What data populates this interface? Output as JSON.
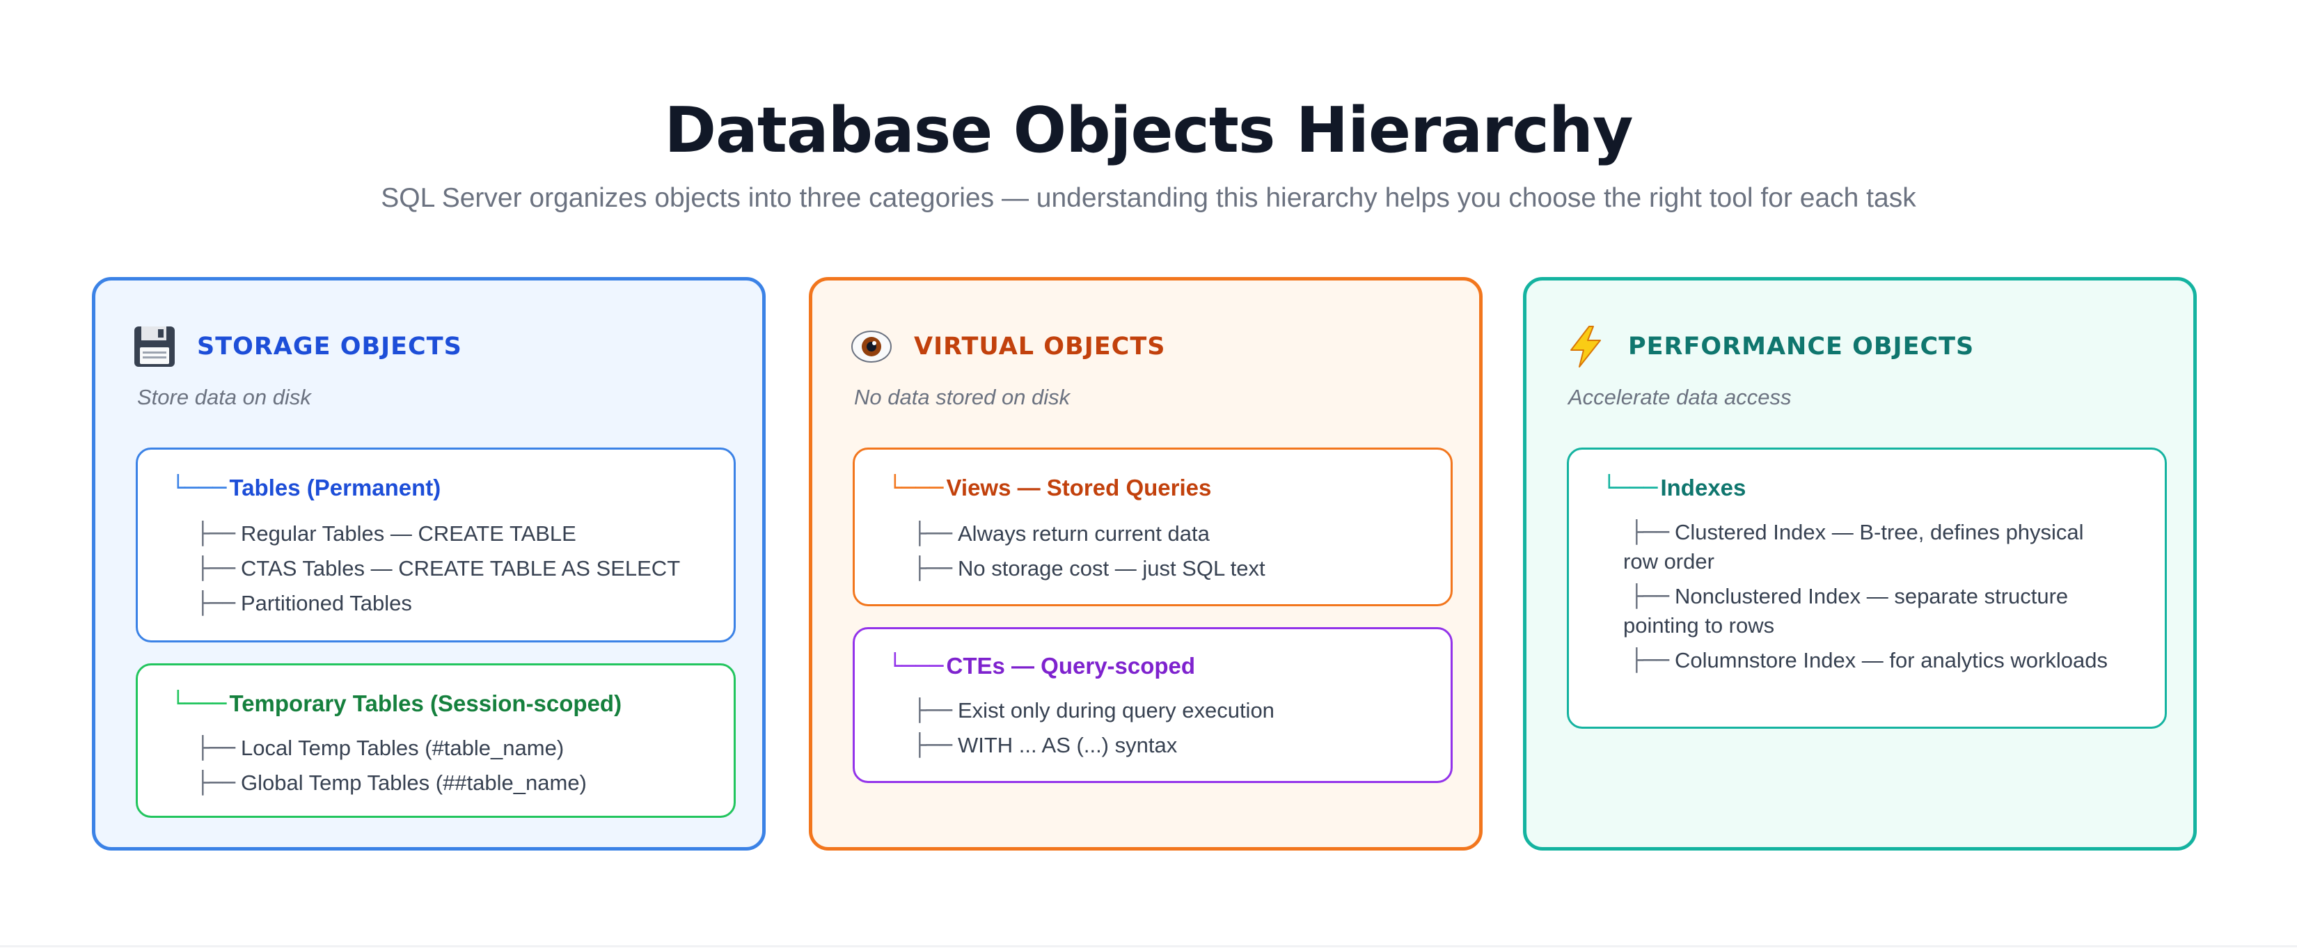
{
  "header": {
    "title": "Database Objects Hierarchy",
    "subtitle": "SQL Server organizes objects into three categories — understanding this hierarchy helps you choose the right tool for each task"
  },
  "colors": {
    "storage": "#3b82e6",
    "virtual": "#f2761d",
    "performance": "#14b3a0",
    "temporary": "#22c55e",
    "cte": "#9333ea"
  },
  "branch": {
    "head": "└───",
    "item": "├──"
  },
  "storage": {
    "icon": "floppy-disk-icon",
    "title": "STORAGE OBJECTS",
    "subtitle": "Store data on disk",
    "cards": [
      {
        "title": "Tables (Permanent)",
        "items": [
          "Regular Tables — CREATE TABLE",
          "CTAS Tables — CREATE TABLE AS SELECT",
          "Partitioned Tables"
        ]
      },
      {
        "title": "Temporary Tables (Session-scoped)",
        "items": [
          "Local Temp Tables (#table_name)",
          "Global Temp Tables (##table_name)"
        ]
      }
    ]
  },
  "virtual": {
    "icon": "eye-icon",
    "title": "VIRTUAL OBJECTS",
    "subtitle": "No data stored on disk",
    "cards": [
      {
        "title": "Views — Stored Queries",
        "items": [
          "Always return current data",
          "No storage cost — just SQL text"
        ]
      },
      {
        "title": "CTEs — Query-scoped",
        "items": [
          "Exist only during query execution",
          "WITH ... AS (...) syntax"
        ]
      }
    ]
  },
  "performance": {
    "icon": "lightning-icon",
    "title": "PERFORMANCE OBJECTS",
    "subtitle": "Accelerate data access",
    "cards": [
      {
        "title": "Indexes",
        "items": [
          "Clustered Index — B-tree, defines physical row order",
          "Nonclustered Index — separate structure pointing to rows",
          "Columnstore Index — for analytics workloads"
        ]
      }
    ]
  }
}
